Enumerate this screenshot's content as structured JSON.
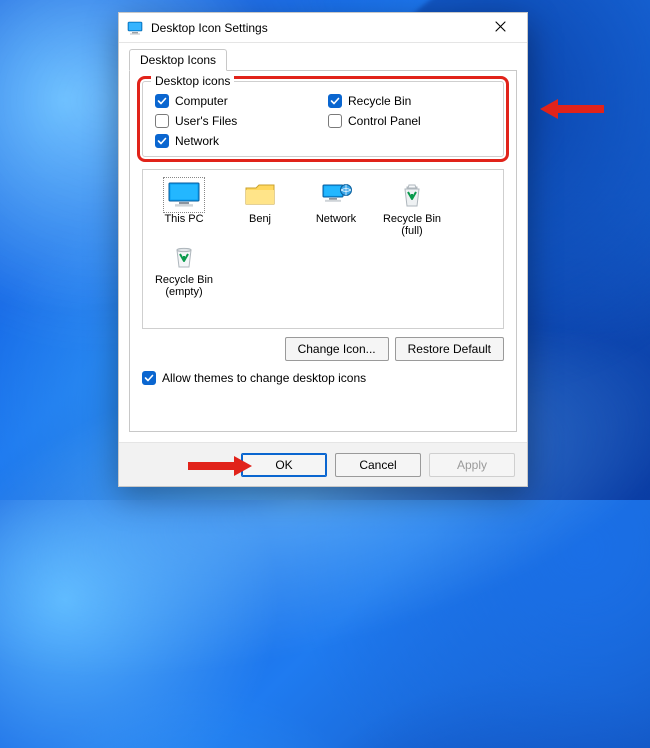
{
  "title": "Desktop Icon Settings",
  "tab": "Desktop Icons",
  "group_legend": "Desktop icons",
  "checks": {
    "computer": {
      "label": "Computer",
      "checked": true
    },
    "userfiles": {
      "label": "User's Files",
      "checked": false
    },
    "network": {
      "label": "Network",
      "checked": true
    },
    "recyclebin": {
      "label": "Recycle Bin",
      "checked": true
    },
    "controlpanel": {
      "label": "Control Panel",
      "checked": false
    }
  },
  "preview": {
    "this_pc": "This PC",
    "user_folder": "Benj",
    "network": "Network",
    "recycle_full": "Recycle Bin (full)",
    "recycle_empty": "Recycle Bin (empty)"
  },
  "buttons": {
    "change_icon": "Change Icon...",
    "restore_default": "Restore Default",
    "ok": "OK",
    "cancel": "Cancel",
    "apply": "Apply"
  },
  "allow_themes": {
    "label": "Allow themes to change desktop icons",
    "checked": true
  }
}
